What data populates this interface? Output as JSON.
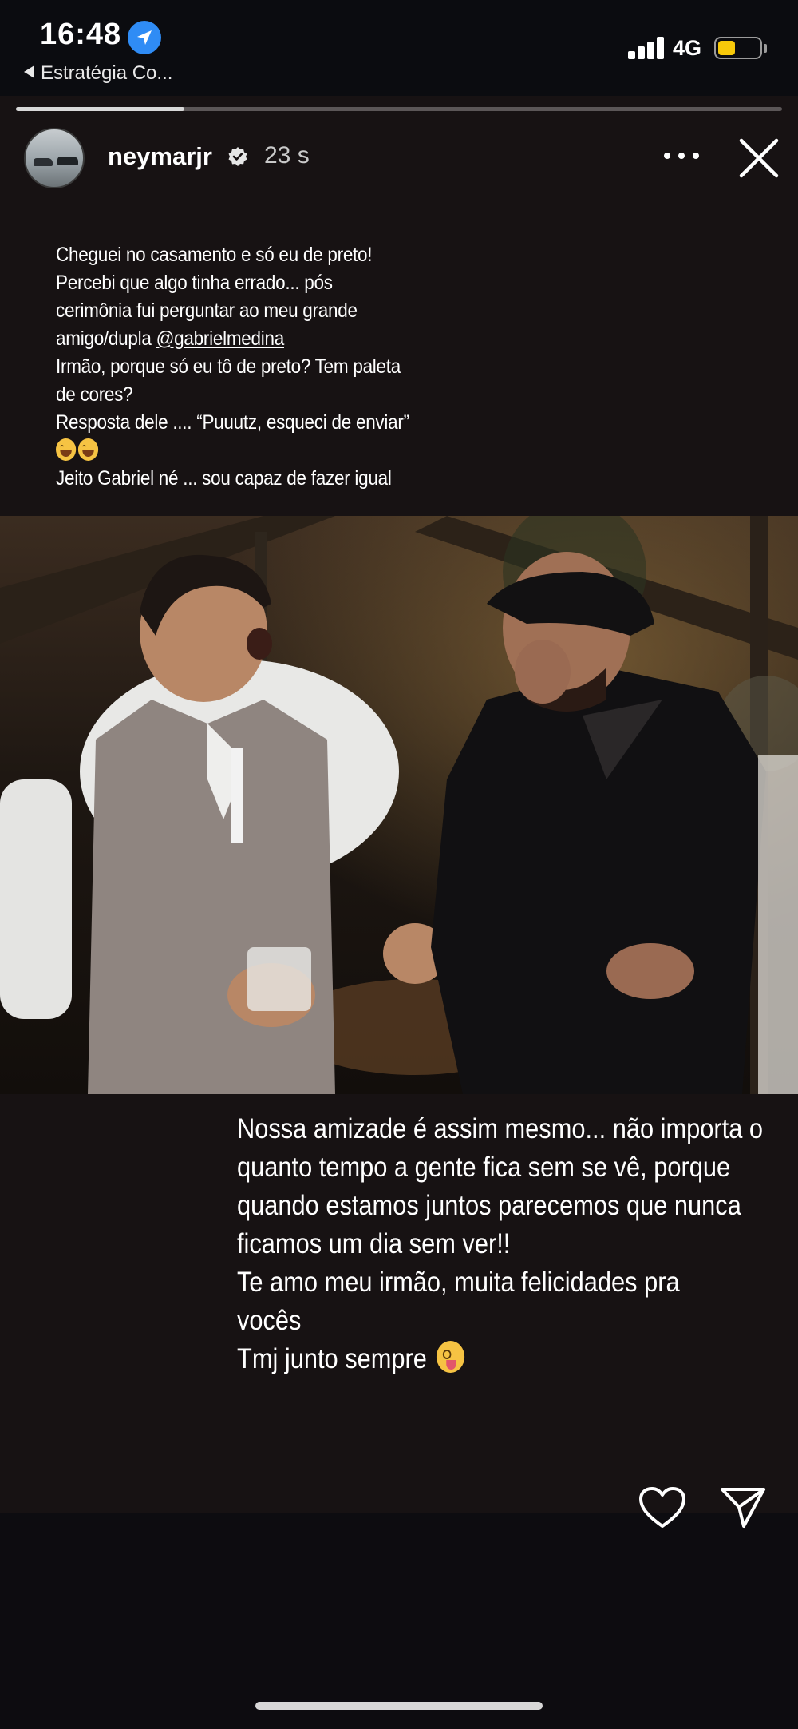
{
  "status_bar": {
    "time": "16:48",
    "back_label": "Estratégia Co...",
    "network": "4G",
    "battery_color": "#f7c90a",
    "icons": [
      "location-icon",
      "signal-icon",
      "battery-icon"
    ]
  },
  "story": {
    "progress": 0.22,
    "username": "neymarjr",
    "timestamp": "23 s",
    "verified": true,
    "caption_top": [
      "Cheguei no casamento e só eu de preto!",
      "Percebi que algo tinha errado... pós",
      "cerimônia fui perguntar ao meu grande",
      "amigo/dupla ",
      "Irmão, porque só eu tô de preto? Tem paleta",
      "de cores?",
      "Resposta dele .... “Puuutz, esqueci de enviar”",
      "",
      "Jeito Gabriel né ... sou capaz de fazer igual"
    ],
    "mention": "@gabrielmedina",
    "caption_bottom": [
      "Nossa amizade é assim mesmo... não importa o",
      "quanto tempo a gente fica sem se vê, porque",
      "quando estamos juntos parecemos que nunca",
      "ficamos um dia sem ver!!",
      "Te amo meu irmão, muita felicidades pra",
      "vocês",
      "Tmj junto sempre "
    ],
    "icons": [
      "more-icon",
      "close-icon",
      "heart-icon",
      "send-icon"
    ]
  }
}
